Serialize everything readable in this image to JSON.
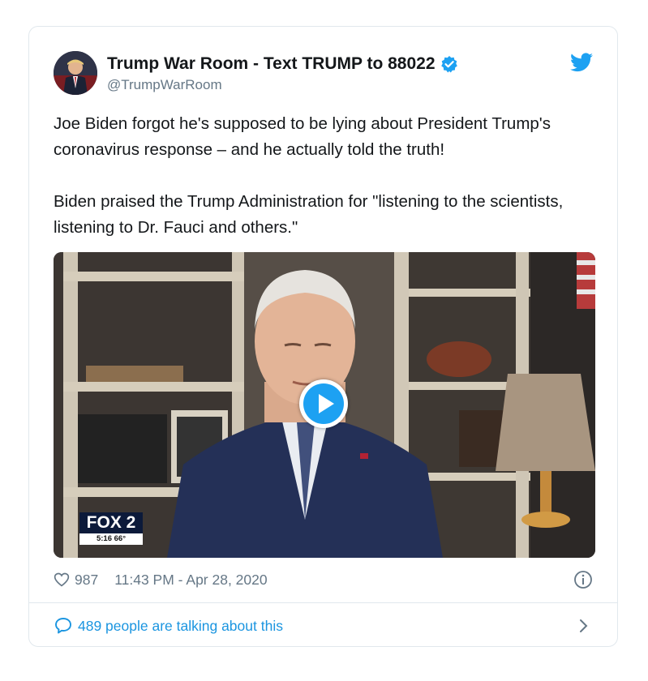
{
  "tweet": {
    "display_name": "Trump War Room - Text TRUMP to 88022",
    "handle": "@TrumpWarRoom",
    "text": [
      "Joe Biden forgot he's supposed to be lying about President Trump's coronavirus response – and he actually told the truth!",
      "Biden praised the Trump Administration for \"listening to the scientists, listening to Dr. Fauci and others.\""
    ],
    "likes": "987",
    "timestamp": "11:43 PM - Apr 28, 2020",
    "talking": "489 people are talking about this"
  },
  "video_overlay": {
    "channel": "FOX 2",
    "time_temp": "5:16  66°"
  },
  "icons": {
    "verified": "verified-badge-icon",
    "brand": "twitter-bird-icon",
    "like": "heart-icon",
    "info": "info-icon",
    "reply": "speech-bubble-icon",
    "more": "chevron-right-icon",
    "play": "play-icon"
  },
  "colors": {
    "accent": "#1da1f2",
    "link": "#1b95e0",
    "muted": "#657786",
    "text": "#14171a"
  }
}
